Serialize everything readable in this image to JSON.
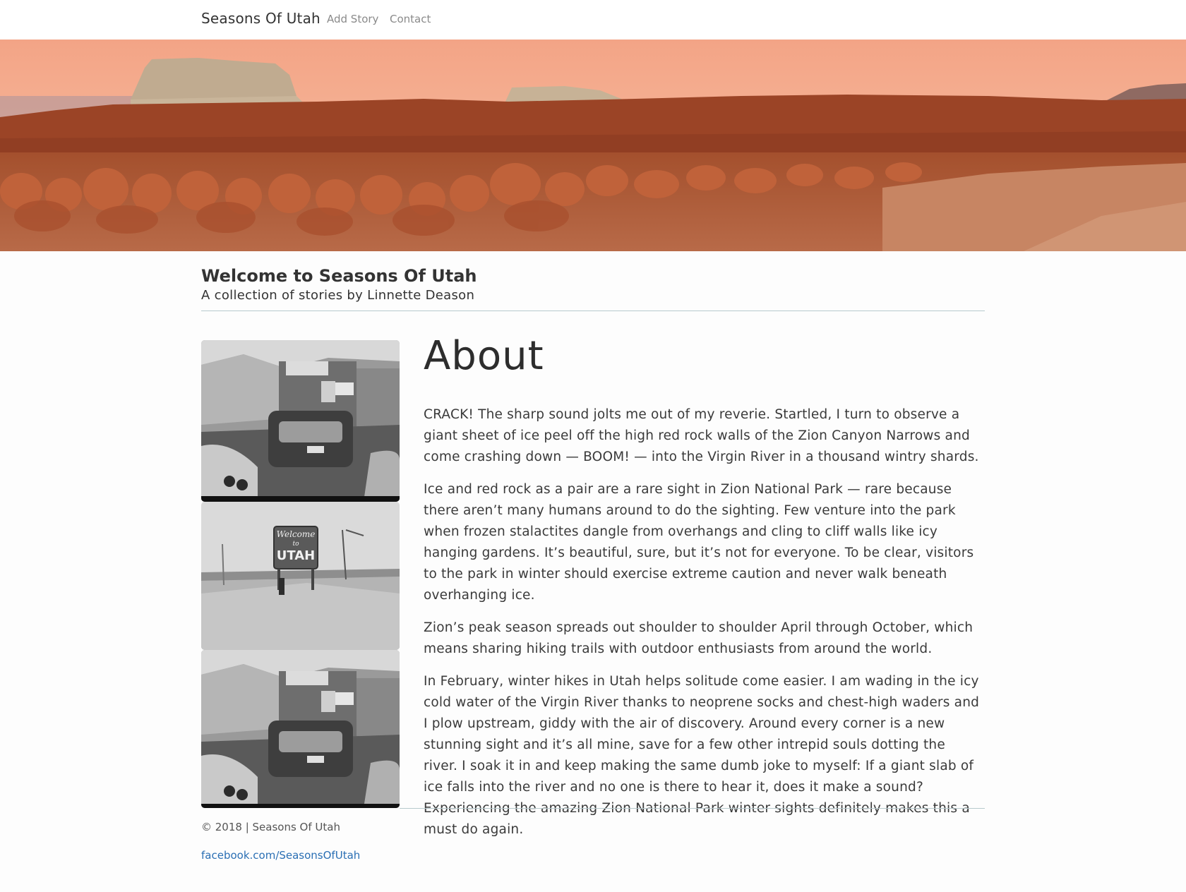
{
  "nav": {
    "brand": "Seasons Of Utah",
    "links": [
      {
        "label": "Add Story"
      },
      {
        "label": "Contact"
      }
    ]
  },
  "hero": {
    "image": "desert-hoodoo-panorama"
  },
  "header": {
    "title": "Welcome to Seasons Of Utah",
    "subtitle": "A collection of stories by Linnette Deason"
  },
  "gallery": [
    {
      "image": "vintage-street-photo"
    },
    {
      "image": "welcome-to-utah-sign-photo",
      "sign_text": [
        "Welcome",
        "to",
        "UTAH"
      ]
    },
    {
      "image": "vintage-street-photo"
    }
  ],
  "about": {
    "title": "About",
    "paragraphs": [
      "CRACK! The sharp sound jolts me out of my reverie. Startled, I turn to observe a giant sheet of ice peel off the high red rock walls of the Zion Canyon Narrows and come crashing down — BOOM! — into the Virgin River in a thousand wintry shards.",
      "Ice and red rock as a pair are a rare sight in Zion National Park — rare because there aren’t many humans around to do the sighting. Few venture into the park when frozen stalactites dangle from overhangs and cling to cliff walls like icy hanging gardens. It’s beautiful, sure, but it’s not for everyone. To be clear, visitors to the park in winter should exercise extreme caution and never walk beneath overhanging ice.",
      "Zion’s peak season spreads out shoulder to shoulder April through October, which means sharing hiking trails with outdoor enthusiasts from around the world.",
      "In February, winter hikes in Utah helps solitude come easier. I am wading in the icy cold water of the Virgin River thanks to neoprene socks and chest-high waders and I plow upstream, giddy with the air of discovery. Around every corner is a new stunning sight and it’s all mine, save for a few other intrepid souls dotting the river. I soak it in and keep making the same dumb joke to myself: If a giant slab of ice falls into the river and no one is there to hear it, does it make a sound? Experiencing the amazing Zion National Park winter sights definitely makes this a must do again."
    ]
  },
  "footer": {
    "copyright": "© 2018 | Seasons Of Utah",
    "facebook": "facebook.com/SeasonsOfUtah"
  },
  "colors": {
    "link": "#2a6fb4",
    "rule": "#b7c9cd",
    "rock": "#b85c35",
    "sky": "#f2a98a"
  }
}
